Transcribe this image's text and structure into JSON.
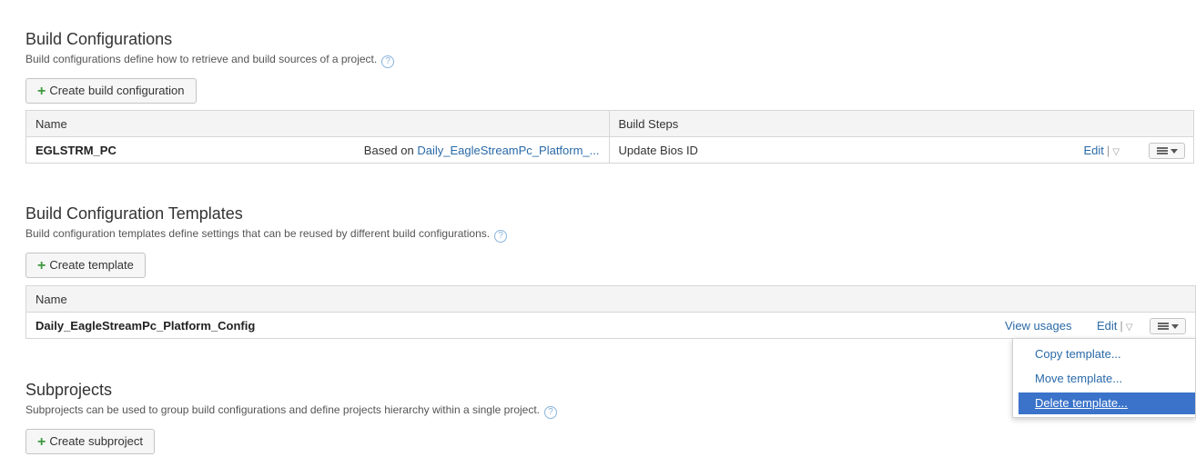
{
  "build_configurations": {
    "title": "Build Configurations",
    "description": "Build configurations define how to retrieve and build sources of a project.",
    "help": "?",
    "create_button": "Create build configuration",
    "columns": [
      "Name",
      "Build Steps"
    ],
    "rows": [
      {
        "name": "EGLSTRM_PC",
        "based_on_prefix": "Based on",
        "based_on_link": "Daily_EagleStreamPc_Platform_...",
        "build_steps": "Update Bios ID",
        "edit": "Edit",
        "sep": "|",
        "edit_caret": "▽"
      }
    ]
  },
  "templates": {
    "title": "Build Configuration Templates",
    "description": "Build configuration templates define settings that can be reused by different build configurations.",
    "help": "?",
    "create_button": "Create template",
    "columns": [
      "Name"
    ],
    "rows": [
      {
        "name": "Daily_EagleStreamPc_Platform_Config",
        "view_usages": "View usages",
        "edit": "Edit",
        "sep": "|",
        "edit_caret": "▽"
      }
    ],
    "menu": [
      "Copy template...",
      "Move template...",
      "Delete template..."
    ],
    "menu_selected_index": 2
  },
  "subprojects": {
    "title": "Subprojects",
    "description": "Subprojects can be used to group build configurations and define projects hierarchy within a single project.",
    "help": "?",
    "create_button": "Create subproject"
  },
  "icons": {
    "plus": "+",
    "actions_menu": "list-icon"
  },
  "colors": {
    "link": "#2a6aa8",
    "add_green": "#3d9a3d",
    "menu_highlight": "#3a73c9"
  }
}
